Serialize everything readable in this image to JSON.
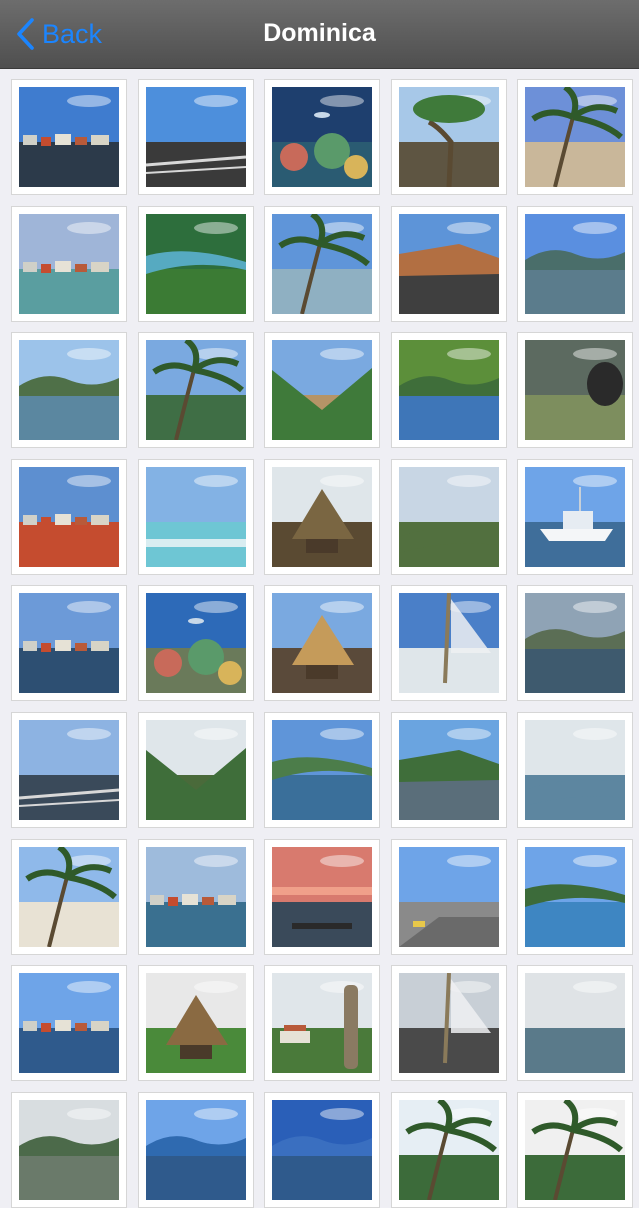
{
  "navbar": {
    "back_label": "Back",
    "title": "Dominica"
  },
  "colors": {
    "accent": "#1b85ff",
    "navbar": "#5a5a5a",
    "background": "#efeff4"
  },
  "gallery": {
    "photos": [
      {
        "name": "photo-harbor-town",
        "sky": "#3f7ccf",
        "mid": "#6d6a5e",
        "ground": "#2c3a4a",
        "feature": "town"
      },
      {
        "name": "photo-coastal-rail",
        "sky": "#4d8fdc",
        "mid": "#2d5e86",
        "ground": "#3a3a3a",
        "feature": "rail"
      },
      {
        "name": "photo-coral-reef",
        "sky": "#1e3f6e",
        "mid": "#2f6088",
        "ground": "#2a5b72",
        "feature": "reef"
      },
      {
        "name": "photo-tree-beach",
        "sky": "#a7c8e8",
        "mid": "#4aa7c3",
        "ground": "#5e5542",
        "feature": "tree"
      },
      {
        "name": "photo-palm-beach",
        "sky": "#6d90d8",
        "mid": "#5bb3c6",
        "ground": "#c9b79a",
        "feature": "palm"
      },
      {
        "name": "photo-resort-bay",
        "sky": "#9fb5d8",
        "mid": "#6d6a5e",
        "ground": "#5a9ea0",
        "feature": "town"
      },
      {
        "name": "photo-green-cove",
        "sky": "#2d6e3c",
        "mid": "#56aac1",
        "ground": "#3b7b34",
        "feature": "cove"
      },
      {
        "name": "photo-leaning-palm",
        "sky": "#5f95d9",
        "mid": "#3a6e5a",
        "ground": "#8fb0c2",
        "feature": "palm"
      },
      {
        "name": "photo-red-cliff",
        "sky": "#5d94d8",
        "mid": "#b26f42",
        "ground": "#3f3f3f",
        "feature": "cliff"
      },
      {
        "name": "photo-calm-bay",
        "sky": "#5a8fe0",
        "mid": "#4a6e6a",
        "ground": "#5b7c8c",
        "feature": "hills"
      },
      {
        "name": "photo-mountain-bay",
        "sky": "#9cc3ea",
        "mid": "#4f7048",
        "ground": "#5b87a0",
        "feature": "hills"
      },
      {
        "name": "photo-palm-fronds",
        "sky": "#7aa9e0",
        "mid": "#3a6b9a",
        "ground": "#3f6e45",
        "feature": "palm"
      },
      {
        "name": "photo-valley-road",
        "sky": "#7aa9e0",
        "mid": "#3f7a3a",
        "ground": "#b59467",
        "feature": "valley"
      },
      {
        "name": "photo-marina-hills",
        "sky": "#5c8f3a",
        "mid": "#3f6e3a",
        "ground": "#3e76b8",
        "feature": "hills"
      },
      {
        "name": "photo-diver-rock",
        "sky": "#5c6a60",
        "mid": "#6b7a62",
        "ground": "#7d8e5e",
        "feature": "rock"
      },
      {
        "name": "photo-market-harbor",
        "sky": "#5d8fd0",
        "mid": "#2f4d6e",
        "ground": "#c54c2f",
        "feature": "town"
      },
      {
        "name": "photo-surf-beach",
        "sky": "#83b2e4",
        "mid": "#3c6b4a",
        "ground": "#6ec6d4",
        "feature": "beach"
      },
      {
        "name": "photo-thatched-hut",
        "sky": "#dfe6ea",
        "mid": "#7a6642",
        "ground": "#5a4a32",
        "feature": "hut"
      },
      {
        "name": "photo-river-valley",
        "sky": "#c8d6e4",
        "mid": "#4c7d4a",
        "ground": "#52703f",
        "feature": "river"
      },
      {
        "name": "photo-yacht",
        "sky": "#6ea4e8",
        "mid": "#e8eef4",
        "ground": "#3f6e9a",
        "feature": "boat"
      },
      {
        "name": "photo-waterfront-town",
        "sky": "#6c9ad8",
        "mid": "#4a5a4e",
        "ground": "#2d4f72",
        "feature": "town"
      },
      {
        "name": "photo-reef-diver",
        "sky": "#2d6ab8",
        "mid": "#3c6f8e",
        "ground": "#6a7a5a",
        "feature": "reef"
      },
      {
        "name": "photo-beach-bar",
        "sky": "#7aa9e0",
        "mid": "#c59b5a",
        "ground": "#5a4a3a",
        "feature": "hut"
      },
      {
        "name": "photo-sailing-deck",
        "sky": "#4a7fc8",
        "mid": "#2f5a8c",
        "ground": "#dfe6ea",
        "feature": "sail"
      },
      {
        "name": "photo-rainbow-harbor",
        "sky": "#8fa3b5",
        "mid": "#5b6e55",
        "ground": "#3e5a6e",
        "feature": "hills"
      },
      {
        "name": "photo-ship-rail",
        "sky": "#8db3e2",
        "mid": "#4c6e4a",
        "ground": "#3a4a5a",
        "feature": "rail"
      },
      {
        "name": "photo-cliff-trees",
        "sky": "#dfe6ea",
        "mid": "#3f6e3a",
        "ground": "#4a6a3a",
        "feature": "valley"
      },
      {
        "name": "photo-coast-town",
        "sky": "#5f95d9",
        "mid": "#4c7d4a",
        "ground": "#3a6f9a",
        "feature": "cove"
      },
      {
        "name": "photo-rocky-shore",
        "sky": "#6aa4e0",
        "mid": "#3f6e3a",
        "ground": "#5a6e7a",
        "feature": "cliff"
      },
      {
        "name": "photo-lagoon",
        "sky": "#dfe6ea",
        "mid": "#3c6b3a",
        "ground": "#5d86a0",
        "feature": "river"
      },
      {
        "name": "photo-palm-sand",
        "sky": "#8fb9ea",
        "mid": "#3a6b3a",
        "ground": "#e8e2d4",
        "feature": "palm"
      },
      {
        "name": "photo-pier-town",
        "sky": "#9ebbdc",
        "mid": "#b25a3a",
        "ground": "#3a7090",
        "feature": "town"
      },
      {
        "name": "photo-sunset",
        "sky": "#d87a6e",
        "mid": "#5a6e8a",
        "ground": "#3a4a5a",
        "feature": "sunset"
      },
      {
        "name": "photo-coastal-road",
        "sky": "#6ea4e8",
        "mid": "#4a6a4a",
        "ground": "#8a8a8a",
        "feature": "road"
      },
      {
        "name": "photo-peninsula",
        "sky": "#6ea4e8",
        "mid": "#3c6b3a",
        "ground": "#3e86c2",
        "feature": "cove"
      },
      {
        "name": "photo-harbor-village",
        "sky": "#6ea4e8",
        "mid": "#4c7d4a",
        "ground": "#2f5a8c",
        "feature": "town"
      },
      {
        "name": "photo-gazebo",
        "sky": "#e8e8e8",
        "mid": "#8a6a42",
        "ground": "#4a8a3a",
        "feature": "hut"
      },
      {
        "name": "photo-carved-pole",
        "sky": "#e0e6ea",
        "mid": "#5a7a4a",
        "ground": "#4a7a3a",
        "feature": "pole"
      },
      {
        "name": "photo-sailboat-mast",
        "sky": "#c8cfd6",
        "mid": "#8a7a5a",
        "ground": "#4a4a4a",
        "feature": "sail"
      },
      {
        "name": "photo-inland-lake",
        "sky": "#dfe3e6",
        "mid": "#3c6b3a",
        "ground": "#5a7a8a",
        "feature": "river"
      },
      {
        "name": "photo-misty-hills",
        "sky": "#d8dde0",
        "mid": "#4c6a4a",
        "ground": "#6a7a6a",
        "feature": "hills"
      },
      {
        "name": "photo-blue-sea",
        "sky": "#6ea4e8",
        "mid": "#2f6ab0",
        "ground": "#2f5a8c",
        "feature": "hills"
      },
      {
        "name": "photo-deep-sky",
        "sky": "#2a5fb8",
        "mid": "#3a6fc0",
        "ground": "#2f5a8c",
        "feature": "hills"
      },
      {
        "name": "photo-palm-grove",
        "sky": "#e6eef4",
        "mid": "#4a7a3a",
        "ground": "#3c6b3a",
        "feature": "palm"
      },
      {
        "name": "photo-palm-silhouette",
        "sky": "#f0f0f0",
        "mid": "#3f6e3a",
        "ground": "#3c6b3a",
        "feature": "palm"
      }
    ]
  }
}
